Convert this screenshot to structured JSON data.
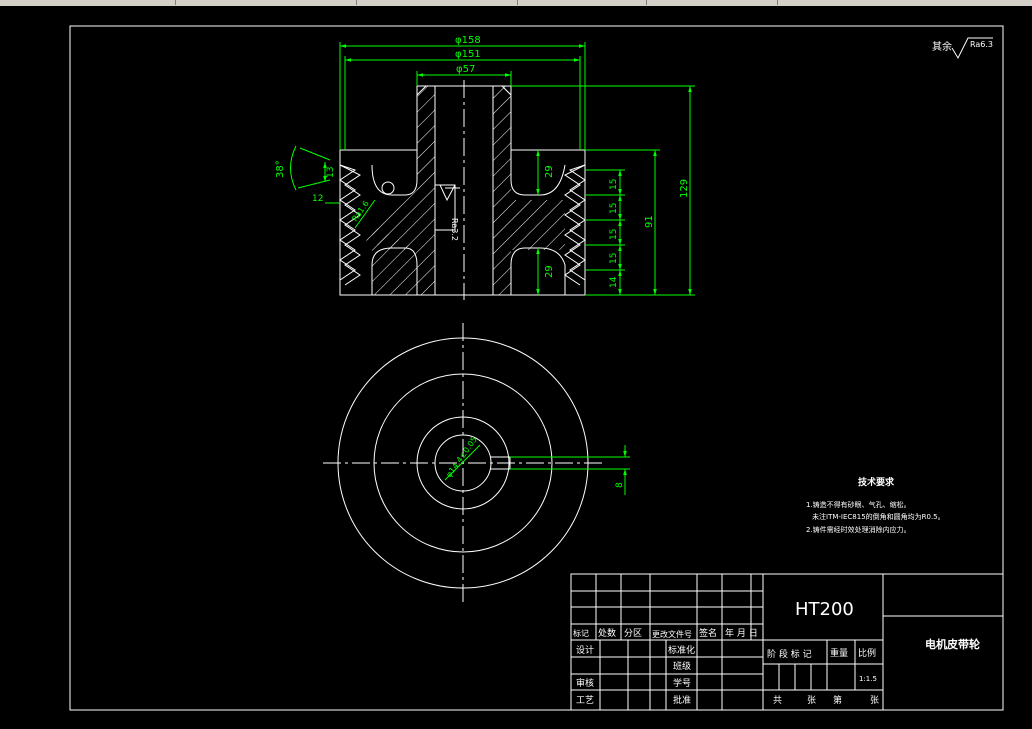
{
  "colors": {
    "background": "#000000",
    "lines": "#ffffff",
    "dimensions": "#00ff00",
    "window_bar": "#d4d0c8"
  },
  "dimensions": {
    "d158": "φ158",
    "d151": "φ151",
    "d57": "φ57",
    "angle": "38°",
    "h13": "13",
    "w12": "12",
    "v29a": "29",
    "v29b": "29",
    "p15_1": "15",
    "p15_2": "15",
    "p15_3": "15",
    "p15_4": "15",
    "p14": "14",
    "h91": "91",
    "h129": "129",
    "key8": "8",
    "bore": "φ14.4±0.05",
    "ra_left": "Ra1.6",
    "ra_hub": "Ra3.2"
  },
  "surface_finish": {
    "prefix": "其余",
    "value": "Ra6.3"
  },
  "tech_requirements": {
    "title": "技术要求",
    "line1": "1.铸造不得有砂眼、气孔、缩松。",
    "line2": "未注ITM-IEC815的倒角和圆角均为R0.5。",
    "line3": "2.铸件需经时效处理消除内应力。"
  },
  "title_block": {
    "material": "HT200",
    "part_name": "电机皮带轮",
    "headers": [
      "标记",
      "处数",
      "分区",
      "更改文件号",
      "签名",
      "年 月 日"
    ],
    "roles": [
      "设计",
      "审核",
      "工艺"
    ],
    "standardize": "标准化",
    "class_label": "班级",
    "student_no": "学号",
    "approve": "批准",
    "stage_mark": "阶 段 标 记",
    "weight": "重量",
    "scale_label": "比例",
    "scale_value": "1:1.5",
    "sheets": [
      "共",
      "张",
      "第",
      "张"
    ]
  }
}
